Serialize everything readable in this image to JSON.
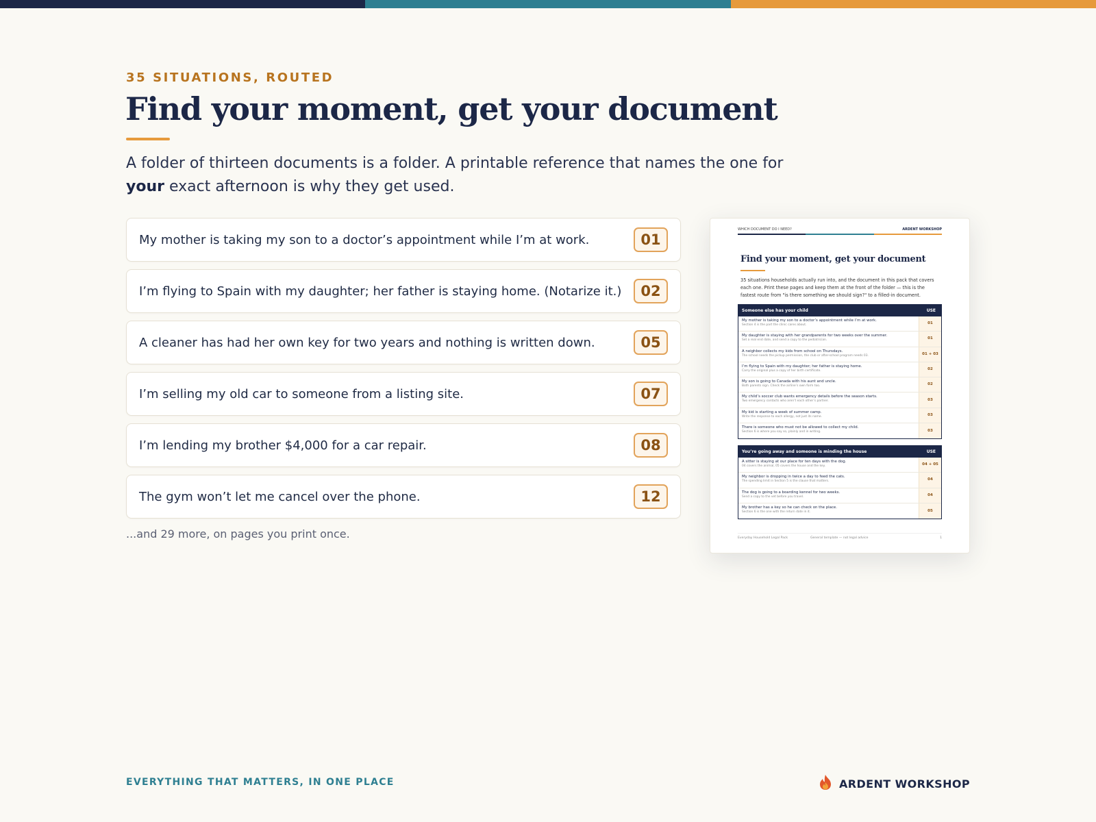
{
  "colors": {
    "navy": "#1c2747",
    "teal": "#2e7f91",
    "orange": "#e69a3c",
    "badge_text": "#8a5214"
  },
  "eyebrow": "35 SITUATIONS, ROUTED",
  "headline": "Find your moment, get your document",
  "intro": {
    "part1": "A folder of thirteen documents is a folder. A printable reference that names the one for ",
    "emphasis": "your",
    "part2": " exact afternoon is why they get used."
  },
  "situations": [
    {
      "text": "My mother is taking my son to a doctor’s appointment while I’m at work.",
      "doc": "01"
    },
    {
      "text": "I’m flying to Spain with my daughter; her father is staying home. (Notarize it.)",
      "doc": "02"
    },
    {
      "text": "A cleaner has had her own key for two years and nothing is written down.",
      "doc": "05"
    },
    {
      "text": "I’m selling my old car to someone from a listing site.",
      "doc": "07"
    },
    {
      "text": "I’m lending my brother $4,000 for a car repair.",
      "doc": "08"
    },
    {
      "text": "The gym won’t let me cancel over the phone.",
      "doc": "12"
    }
  ],
  "more_note": "...and 29 more, on pages you print once.",
  "preview": {
    "header_left": "WHICH DOCUMENT DO I NEED?",
    "header_right": "ARDENT WORKSHOP",
    "title": "Find your moment, get your document",
    "intro": "35 situations households actually run into, and the document in this pack that covers each one. Print these pages and keep them at the front of the folder — this is the fastest route from \"is there something we should sign?\" to a filled-in document.",
    "sections": [
      {
        "title": "Someone else has your child",
        "use_label": "USE",
        "rows": [
          {
            "main": "My mother is taking my son to a doctor’s appointment while I’m at work.",
            "sub": "Section 4 is the part the clinic cares about.",
            "doc": "01"
          },
          {
            "main": "My daughter is staying with her grandparents for two weeks over the summer.",
            "sub": "Set a real end date, and send a copy to the pediatrician.",
            "doc": "01"
          },
          {
            "main": "A neighbor collects my kids from school on Thursdays.",
            "sub": "The school needs the pickup permission, the club or after-school program needs 03.",
            "doc": "01 + 03"
          },
          {
            "main": "I’m flying to Spain with my daughter; her father is staying home.",
            "sub": "Carry the original plus a copy of her birth certificate.",
            "doc": "02"
          },
          {
            "main": "My son is going to Canada with his aunt and uncle.",
            "sub": "Both parents sign. Check the airline’s own form too.",
            "doc": "02"
          },
          {
            "main": "My child’s soccer club wants emergency details before the season starts.",
            "sub": "Two emergency contacts who aren’t each other’s partner.",
            "doc": "03"
          },
          {
            "main": "My kid is starting a week of summer camp.",
            "sub": "Write the response to each allergy, not just its name.",
            "doc": "03"
          },
          {
            "main": "There is someone who must not be allowed to collect my child.",
            "sub": "Section 6 is where you say so, plainly and in writing.",
            "doc": "03"
          }
        ]
      },
      {
        "title": "You’re going away and someone is minding the house",
        "use_label": "USE",
        "rows": [
          {
            "main": "A sitter is staying at our place for ten days with the dog.",
            "sub": "04 covers the animal, 05 covers the house and the key.",
            "doc": "04 + 05"
          },
          {
            "main": "My neighbor is dropping in twice a day to feed the cats.",
            "sub": "The spending limit in Section 5 is the clause that matters.",
            "doc": "04"
          },
          {
            "main": "The dog is going to a boarding kennel for two weeks.",
            "sub": "Send a copy to the vet before you travel.",
            "doc": "04"
          },
          {
            "main": "My brother has a key so he can check on the place.",
            "sub": "Section 6 is the one with the return date in it.",
            "doc": "05"
          }
        ]
      }
    ],
    "footer": {
      "left": "Everyday Household Legal Pack",
      "middle": "General template — not legal advice",
      "page": "1"
    }
  },
  "footer": {
    "tagline": "EVERYTHING THAT MATTERS, IN ONE PLACE",
    "brand": "ARDENT WORKSHOP",
    "logo_icon": "flame-icon"
  }
}
